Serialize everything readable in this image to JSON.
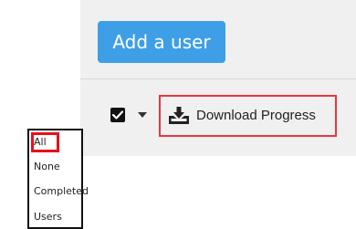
{
  "header": {
    "add_user_label": "Add a user"
  },
  "toolbar": {
    "download_label": "Download Progress",
    "icons": {
      "checkbox": "checkbox-checked-icon",
      "caret": "caret-down-icon",
      "download": "download-tray-icon"
    }
  },
  "dropdown": {
    "items": [
      {
        "label": "All"
      },
      {
        "label": "None"
      },
      {
        "label": "Completed"
      },
      {
        "label": "Users"
      }
    ]
  },
  "colors": {
    "primary_button": "#3e9fe6",
    "highlight_border": "#e5373f",
    "panel_background": "#f0f0f0"
  }
}
